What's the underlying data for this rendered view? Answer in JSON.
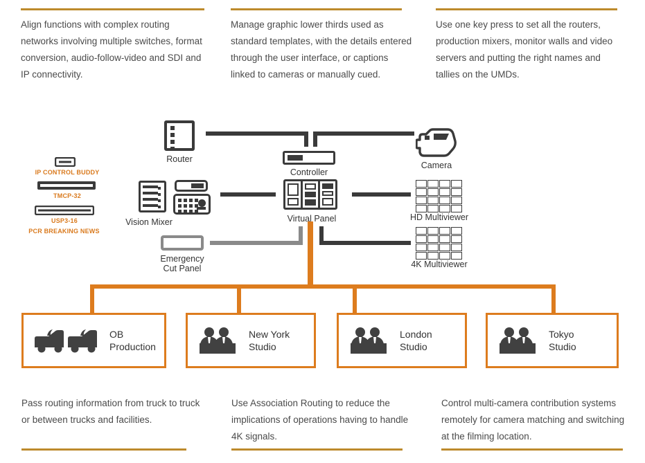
{
  "notes_top": [
    {
      "text": "Align functions with complex routing networks involving multiple switches, format conversion, audio-follow-video and SDI and IP connectivity."
    },
    {
      "text": "Manage graphic lower thirds used as standard templates, with the details entered through the user interface, or captions linked to cameras or manually cued."
    },
    {
      "text": "Use one key press to set all the routers, production mixers, monitor walls and video servers and putting the right names and tallies on the UMDs."
    }
  ],
  "notes_bottom": [
    {
      "text": "Pass routing information from truck to truck or between trucks and facilities."
    },
    {
      "text": "Use Association Routing to reduce the implications of operations having to handle 4K signals."
    },
    {
      "text": "Control multi-camera contribution systems remotely for camera matching and switching at the filming location."
    }
  ],
  "products": [
    {
      "label": "IP CONTROL BUDDY"
    },
    {
      "label": "TMCP-32"
    },
    {
      "label": "USP3-16"
    },
    {
      "label": "PCR BREAKING NEWS"
    }
  ],
  "devices": {
    "router": "Router",
    "controller": "Controller",
    "camera": "Camera",
    "vision_mixer": "Vision Mixer",
    "virtual_panel": "Virtual Panel",
    "emergency_cut_panel": "Emergency\nCut Panel",
    "hd_multiviewer": "HD Multiviewer",
    "fourk_multiviewer": "4K Multiviewer"
  },
  "sites": [
    {
      "label": "OB\nProduction",
      "icon": "ob-truck-icon"
    },
    {
      "label": "New York\nStudio",
      "icon": "studio-people-icon"
    },
    {
      "label": "London\nStudio",
      "icon": "studio-people-icon"
    },
    {
      "label": "Tokyo\nStudio",
      "icon": "studio-people-icon"
    }
  ],
  "colors": {
    "accent_orange": "#dd7c1e",
    "rule_gold": "#bd8a2c",
    "dark": "#3a3a3a",
    "gray": "#8a8a8a"
  }
}
